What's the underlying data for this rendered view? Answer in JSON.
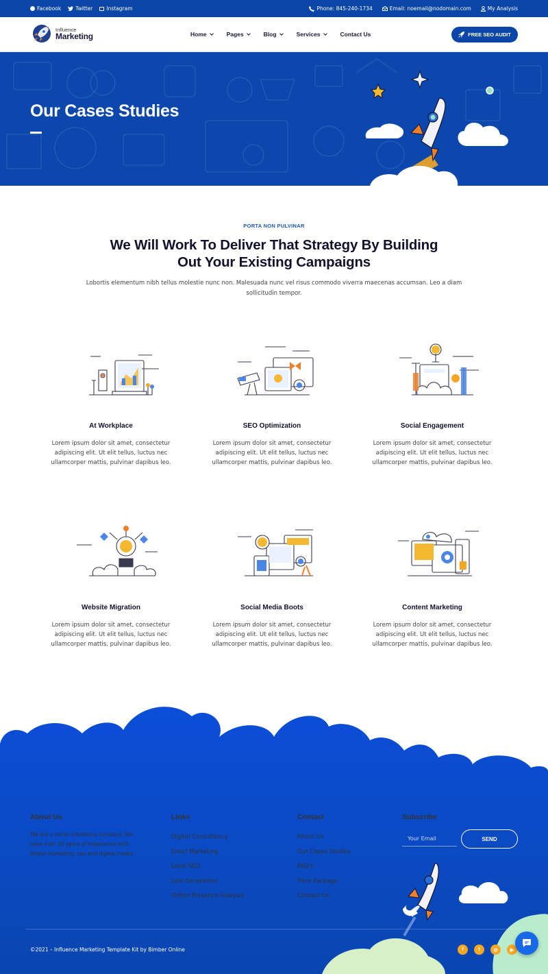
{
  "topbar": {
    "social": [
      {
        "label": "Facebook",
        "icon": "facebook-icon"
      },
      {
        "label": "Twitter",
        "icon": "twitter-icon"
      },
      {
        "label": "Instagram",
        "icon": "instagram-icon"
      }
    ],
    "phone": "Phone: 845-240-1734",
    "email": "Email: noemail@nodomain.com",
    "account": "My Analysis"
  },
  "header": {
    "logo_small": "Influence",
    "logo_big": "Marketing",
    "nav": [
      {
        "label": "Home",
        "dropdown": true
      },
      {
        "label": "Pages",
        "dropdown": true
      },
      {
        "label": "Blog",
        "dropdown": true
      },
      {
        "label": "Services",
        "dropdown": true
      },
      {
        "label": "Contact Us",
        "dropdown": false
      }
    ],
    "cta_label": "FREE SEO AUDIT"
  },
  "hero": {
    "title": "Our Cases Studies"
  },
  "intro": {
    "eyebrow": "PORTA NON PULVINAR",
    "headline_line1": "We Will Work To Deliver That Strategy By Building",
    "headline_line2": "Out Your Existing Campaigns",
    "text": "Lobortis elementum nibh tellus molestie nunc non. Malesuada nunc vel risus commodo viverra maecenas accumsan. Leo a diam sollicitudin tempor."
  },
  "services": [
    {
      "title": "At Workplace",
      "text": "Lorem ipsum dolor sit amet, consectetur adipiscing elit. Ut elit tellus, luctus nec ullamcorper mattis, pulvinar dapibus leo.",
      "icon": "workplace-illustration"
    },
    {
      "title": "SEO Optimization",
      "text": "Lorem ipsum dolor sit amet, consectetur adipiscing elit. Ut elit tellus, luctus nec ullamcorper mattis, pulvinar dapibus leo.",
      "icon": "seo-illustration"
    },
    {
      "title": "Social Engagement",
      "text": "Lorem ipsum dolor sit amet, consectetur adipiscing elit. Ut elit tellus, luctus nec ullamcorper mattis, pulvinar dapibus leo.",
      "icon": "engagement-illustration"
    },
    {
      "title": "Website Migration",
      "text": "Lorem ipsum dolor sit amet, consectetur adipiscing elit. Ut elit tellus, luctus nec ullamcorper mattis, pulvinar dapibus leo.",
      "icon": "migration-illustration"
    },
    {
      "title": "Social Media Boots",
      "text": "Lorem ipsum dolor sit amet, consectetur adipiscing elit. Ut elit tellus, luctus nec ullamcorper mattis, pulvinar dapibus leo.",
      "icon": "social-media-illustration"
    },
    {
      "title": "Content Marketing",
      "text": "Lorem ipsum dolor sit amet, consectetur adipiscing elit. Ut elit tellus, luctus nec ullamcorper mattis, pulvinar dapibus leo.",
      "icon": "content-illustration"
    }
  ],
  "footer": {
    "about_title": "About Us",
    "about_text": "We are a social marketing company. We have over 10 years of experience with digital marketing, seo and digital media.",
    "links_title": "Links",
    "links": [
      "Digital Consultancy",
      "Email Marketing",
      "Local SEO",
      "Link Generation",
      "Online Presence Analysis"
    ],
    "contact_title": "Contact",
    "contact_links": [
      "About Us",
      "Our Cases Studies",
      "FAQ's",
      "Price Package",
      "Contact Us"
    ],
    "subscribe_title": "Subscribe",
    "email_placeholder": "Your Email",
    "send_label": "SEND",
    "copyright": "©2021 – Influence Marketing Template Kit by Bimber Online",
    "socials": [
      "facebook-icon",
      "twitter-icon",
      "instagram-icon",
      "youtube-icon"
    ]
  },
  "colors": {
    "primary": "#0a45a8",
    "hero": "#0b47ad",
    "accent": "#f5a623",
    "heading": "#12122e"
  }
}
